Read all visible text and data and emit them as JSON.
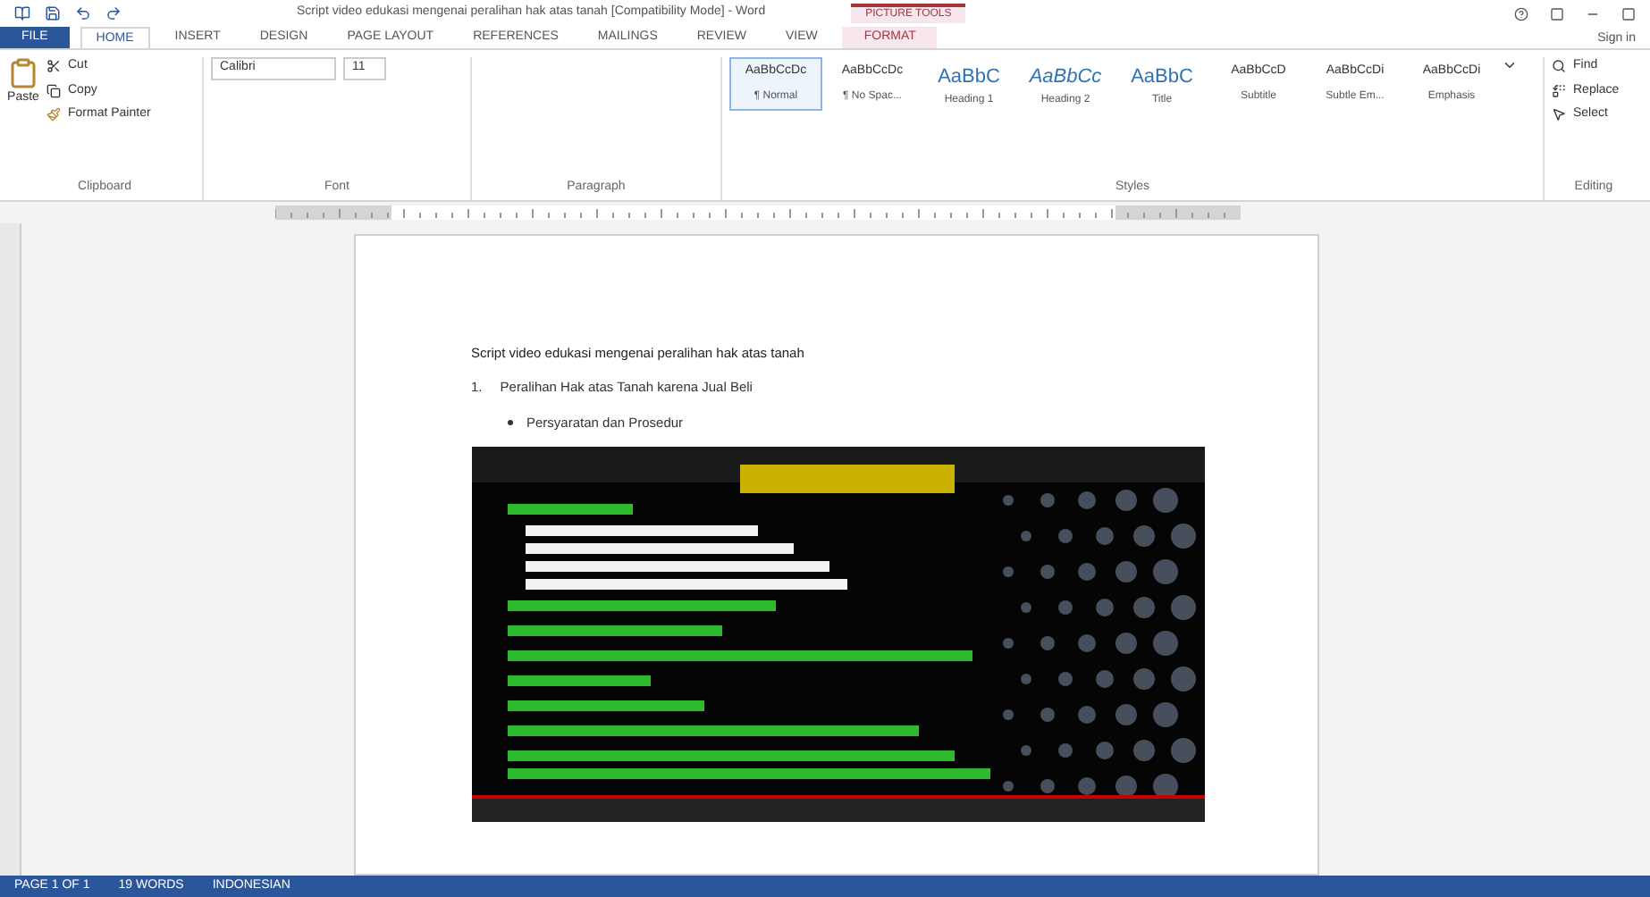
{
  "window": {
    "title": "Script video edukasi mengenai peralihan hak atas tanah [Compatibility Mode] - Word",
    "context_tab": "PICTURE TOOLS",
    "sign_in": "Sign in"
  },
  "tabs": [
    {
      "label": "FILE",
      "selected": false,
      "kind": "file"
    },
    {
      "label": "HOME",
      "selected": true,
      "kind": "tab"
    },
    {
      "label": "INSERT",
      "selected": false,
      "kind": "tab"
    },
    {
      "label": "DESIGN",
      "selected": false,
      "kind": "tab"
    },
    {
      "label": "PAGE LAYOUT",
      "selected": false,
      "kind": "tab"
    },
    {
      "label": "REFERENCES",
      "selected": false,
      "kind": "tab"
    },
    {
      "label": "MAILINGS",
      "selected": false,
      "kind": "tab"
    },
    {
      "label": "REVIEW",
      "selected": false,
      "kind": "tab"
    },
    {
      "label": "VIEW",
      "selected": false,
      "kind": "tab"
    },
    {
      "label": "FORMAT",
      "selected": false,
      "kind": "context"
    }
  ],
  "clipboard": {
    "paste": "Paste",
    "cut": "Cut",
    "copy": "Copy",
    "format_painter": "Format Painter",
    "label": "Clipboard"
  },
  "font": {
    "name": "Calibri",
    "size": "11",
    "label": "Font"
  },
  "paragraph": {
    "label": "Paragraph"
  },
  "styles": {
    "label": "Styles",
    "items": [
      {
        "preview": "AaBbCcDc",
        "name": "¶ Normal",
        "selected": true,
        "kind": "small"
      },
      {
        "preview": "AaBbCcDc",
        "name": "¶ No Spac...",
        "selected": false,
        "kind": "small"
      },
      {
        "preview": "AaBbC",
        "name": "Heading 1",
        "selected": false,
        "kind": "heading"
      },
      {
        "preview": "AaBbCc",
        "name": "Heading 2",
        "selected": false,
        "kind": "italic"
      },
      {
        "preview": "AaBbC",
        "name": "Title",
        "selected": false,
        "kind": "heading"
      },
      {
        "preview": "AaBbCcD",
        "name": "Subtitle",
        "selected": false,
        "kind": "small"
      },
      {
        "preview": "AaBbCcDi",
        "name": "Subtle Em...",
        "selected": false,
        "kind": "small"
      },
      {
        "preview": "AaBbCcDi",
        "name": "Emphasis",
        "selected": false,
        "kind": "small"
      }
    ]
  },
  "editing": {
    "label": "Editing",
    "find": "Find",
    "replace": "Replace",
    "select": "Select"
  },
  "document": {
    "title": "Script video edukasi mengenai peralihan hak atas tanah",
    "list_number": "1.",
    "list_item": "Peralihan Hak atas Tanah karena Jual Beli",
    "bullet_item": "Persyaratan dan Prosedur"
  },
  "status_bar": {
    "page": "PAGE 1 OF 1",
    "words": "19 WORDS",
    "language": "INDONESIAN"
  }
}
